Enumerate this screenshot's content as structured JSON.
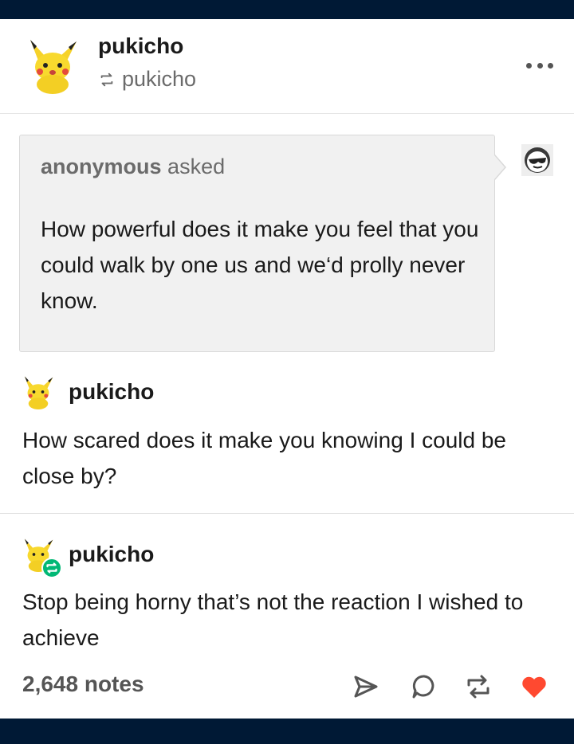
{
  "header": {
    "blog_name": "pukicho",
    "reblogged_from": "pukicho"
  },
  "ask": {
    "asker": "anonymous",
    "asked_word": "asked",
    "question": "How powerful does it make you feel that you could walk by one us and we‘d prolly never know."
  },
  "answer": {
    "name": "pukicho",
    "text": "How scared does it make you knowing I could be close by?"
  },
  "reblog_comment": {
    "name": "pukicho",
    "text": "Stop being horny that’s not the reaction I wished to achieve"
  },
  "footer": {
    "notes": "2,648 notes"
  },
  "colors": {
    "topbar": "#001935",
    "like": "#ff4930",
    "reblog_badge": "#02b875",
    "ask_bg": "#f1f1f1"
  },
  "icons": [
    "more-icon",
    "reblog-icon",
    "share-icon",
    "reply-icon",
    "reblog-icon",
    "heart-icon",
    "pikachu-avatar",
    "anonymous-avatar"
  ]
}
